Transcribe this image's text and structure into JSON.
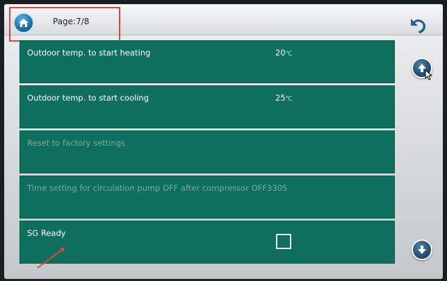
{
  "header": {
    "page_indicator": "Page:7/8",
    "home_icon": "home-icon",
    "back_icon": "undo-back-icon"
  },
  "settings": [
    {
      "label": "Outdoor temp. to start heating",
      "value": "20",
      "unit_glyph": "℃",
      "enabled": true,
      "type": "value"
    },
    {
      "label": "Outdoor temp. to start cooling",
      "value": "25",
      "unit_glyph": "℃",
      "enabled": true,
      "type": "value"
    },
    {
      "label": "Reset to factory settings",
      "value": "",
      "enabled": false,
      "type": "action"
    },
    {
      "label": "Time setting for circulation pump OFF after compressor OFF",
      "value": "330S",
      "enabled": false,
      "type": "value"
    },
    {
      "label": "SG Ready",
      "checked": false,
      "enabled": true,
      "type": "checkbox"
    }
  ],
  "scroll": {
    "up_icon": "arrow-up-icon",
    "down_icon": "arrow-down-icon"
  },
  "colors": {
    "row_bg": "#0f6f5e",
    "highlight_box": "#e3463d",
    "annotation_arrow": "#e3463d"
  }
}
